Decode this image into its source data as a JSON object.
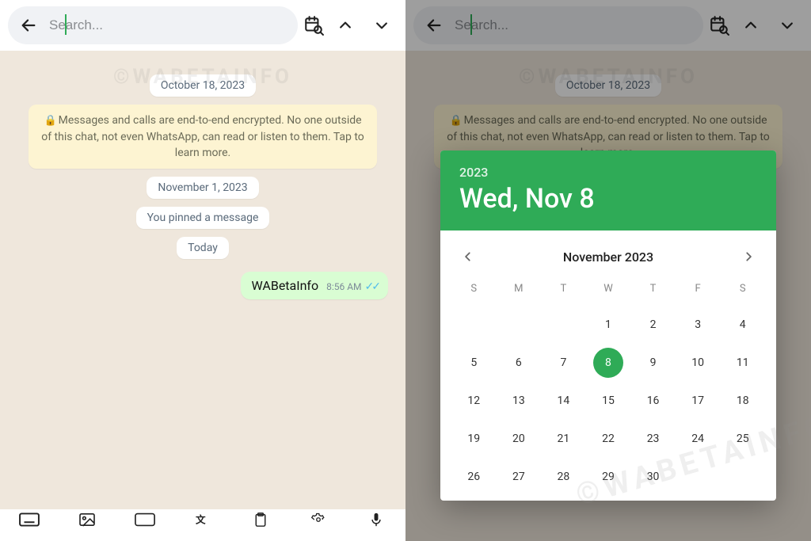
{
  "search": {
    "placeholder": "Search..."
  },
  "watermark": "©WABETAINFO",
  "chat": {
    "date1": "October 18, 2023",
    "encryption": "Messages and calls are end-to-end encrypted. No one outside of this chat, not even WhatsApp, can read or listen to them. Tap to learn more.",
    "date2": "November 1, 2023",
    "pinned": "You pinned a message",
    "date3": "Today",
    "msg": {
      "text": "WABetaInfo",
      "time": "8:56 AM"
    }
  },
  "picker": {
    "year": "2023",
    "headline": "Wed, Nov 8",
    "month": "November 2023",
    "dow": [
      "S",
      "M",
      "T",
      "W",
      "T",
      "F",
      "S"
    ],
    "selected": 8,
    "firstDayCol": 3,
    "daysInMonth": 30
  }
}
